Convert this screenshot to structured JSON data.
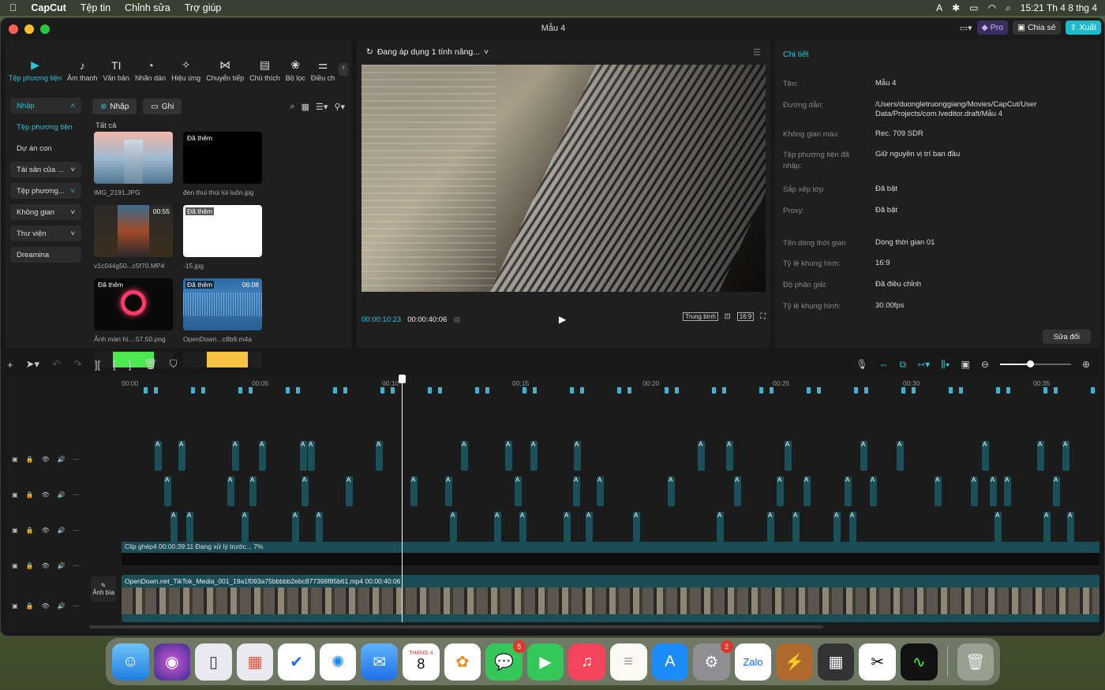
{
  "menubar": {
    "app": "CapCut",
    "items": [
      "Tệp tin",
      "Chỉnh sửa",
      "Trợ giúp"
    ],
    "clock": "15:21 Th 4 8 thg 4",
    "input_indicator": "A"
  },
  "window": {
    "title": "Mẫu 4",
    "pro_label": "Pro",
    "share_label": "Chia sẻ",
    "export_label": "Xuất"
  },
  "tools": [
    {
      "label": "Tệp phương tiện",
      "icon": "media-icon"
    },
    {
      "label": "Âm thanh",
      "icon": "audio-icon"
    },
    {
      "label": "Văn bản",
      "icon": "text-icon"
    },
    {
      "label": "Nhãn dán",
      "icon": "sticker-icon"
    },
    {
      "label": "Hiệu ứng",
      "icon": "effects-icon"
    },
    {
      "label": "Chuyển tiếp",
      "icon": "transition-icon"
    },
    {
      "label": "Chú thích",
      "icon": "caption-icon"
    },
    {
      "label": "Bộ lọc",
      "icon": "filter-icon"
    },
    {
      "label": "Điều ch",
      "icon": "adjust-icon"
    }
  ],
  "sidebar": [
    {
      "label": "Nhập"
    },
    {
      "label": "Tệp phương tiện"
    },
    {
      "label": "Dự án con"
    },
    {
      "label": "Tài sản của ..."
    },
    {
      "label": "Tệp phương..."
    },
    {
      "label": "Không gian"
    },
    {
      "label": "Thư viện"
    },
    {
      "label": "Dreamina"
    }
  ],
  "media": {
    "import_label": "Nhập",
    "record_label": "Ghi",
    "filter_all": "Tất cả",
    "items": [
      {
        "label": "IMG_2191.JPG",
        "badge": "",
        "duration": ""
      },
      {
        "label": "đen thui thùi lùi luôn.jpg",
        "badge": "Đã thêm",
        "duration": ""
      },
      {
        "label": "v1c044g50...c5f70.MP4",
        "badge": "",
        "duration": "00:55"
      },
      {
        "label": "-15.jpg",
        "badge": "Đã thêm",
        "duration": ""
      },
      {
        "label": "Ảnh màn hì....57.50.png",
        "badge": "Đã thêm",
        "duration": ""
      },
      {
        "label": "OpenDown...c8b9.m4a",
        "badge": "Đã thêm",
        "duration": "06:08"
      }
    ]
  },
  "preview": {
    "status": "Đang áp dụng 1 tính năng...",
    "current_time": "00:00:10:23",
    "total_time": "00:00:40:06",
    "quality": "Trung bình",
    "ratio": "16:9"
  },
  "details": {
    "title": "Chi tiết",
    "rows": [
      {
        "key": "Tên:",
        "value": "Mẫu 4"
      },
      {
        "key": "Đường dẫn:",
        "value": "/Users/duongletruonggiang/Movies/CapCut/User Data/Projects/com.lveditor.draft/Mẫu 4"
      },
      {
        "key": "Không gian màu",
        "value": "Rec. 709 SDR"
      },
      {
        "key": "Tệp phương tiện đã nhập:",
        "value": "Giữ nguyên vị trí ban đầu"
      },
      {
        "key": "Sắp xếp lớp",
        "value": "Đã bật"
      },
      {
        "key": "Proxy:",
        "value": "Đã bật"
      },
      {
        "key": "Tên dòng thời gian",
        "value": "Dòng thời gian 01"
      },
      {
        "key": "Tỷ lệ khung hình:",
        "value": "16:9"
      },
      {
        "key": "Độ phân giải:",
        "value": "Đã điều chỉnh"
      },
      {
        "key": "Tỷ lệ khung hình:",
        "value": "30.00fps"
      }
    ],
    "edit_label": "Sửa đổi"
  },
  "timeline": {
    "ruler": [
      "00:00",
      "00:05",
      "00:10",
      "00:15",
      "00:20",
      "00:25",
      "00:30",
      "00:35"
    ],
    "compound_label": "Clip ghép4   00:00:39:11   Đang xử lý trước... 7%",
    "main_clip_label": "OpenDown.net_TikTok_Media_001_19a1f093a75bbbbb2ebc877398f85b61.mp4   00:00:40:06",
    "cover_label": "Ảnh bìa"
  },
  "dock": {
    "calendar_month": "THÁNG 4",
    "calendar_day": "8",
    "messages_badge": "5",
    "settings_badge": "2",
    "zalo_label": "Zalo"
  }
}
